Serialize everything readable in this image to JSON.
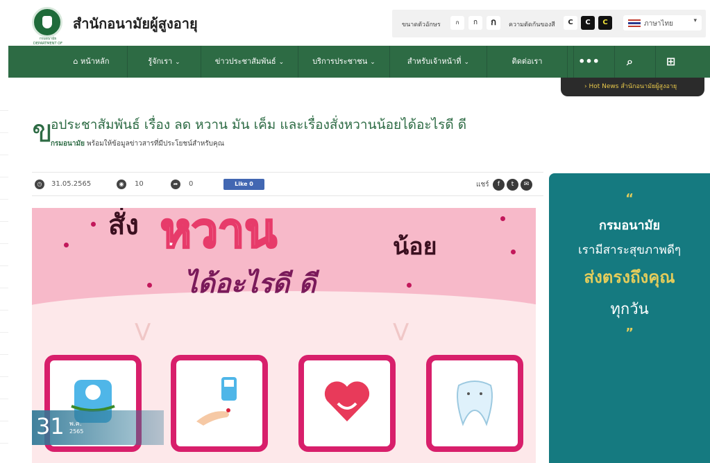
{
  "header": {
    "site_title": "สำนักอนามัยผู้สูงอายุ",
    "logo_caption": "กรมอนามัย DEPARTMENT OF HEALTH",
    "font_size_label": "ขนาดตัวอักษร",
    "font_sizes": [
      "ก",
      "ก",
      "ก"
    ],
    "contrast_label": "ความตัดกันของสี",
    "contrast_options": [
      "C",
      "C",
      "C"
    ],
    "language": "ภาษาไทย"
  },
  "nav": {
    "items": [
      {
        "label": "หน้าหลัก",
        "icon": "home-icon"
      },
      {
        "label": "รู้จักเรา"
      },
      {
        "label": "ข่าวประชาสัมพันธ์"
      },
      {
        "label": "บริการประชาชน"
      },
      {
        "label": "สำหรับเจ้าหน้าที่"
      },
      {
        "label": "ติดต่อเรา"
      }
    ],
    "more": "•••",
    "search": "search-icon",
    "sitemap": "sitemap-icon"
  },
  "hot_news": "Hot News สำนักอนามัยผู้สูงอายุ",
  "article": {
    "lead_letter": "ข",
    "title": "อประชาสัมพันธ์ เรื่อง ลด หวาน มัน เค็ม และเรื่องสั่งหวานน้อยได้อะไรดี ดี",
    "subtitle_bold": "กรมอนามัย",
    "subtitle": "พร้อมให้ข้อมูลข่าวสารที่มีประโยชน์สำหรับคุณ",
    "date": "31.05.2565",
    "views": "10",
    "shares": "0",
    "like": "Like 0",
    "share_label": "แชร์"
  },
  "hero": {
    "line1": "สั่ง",
    "line1_big": "หวาน",
    "line1_end": "น้อย",
    "line2": "ได้อะไรดี ดี",
    "day": "31",
    "month": "พ.ค.",
    "year": "2565"
  },
  "sidebar": {
    "quote_open": "“",
    "line1": "กรมอนามัย",
    "line2": "เรามีสาระสุขภาพดีๆ",
    "line3": "ส่งตรงถึงคุณ",
    "line4": "ทุกวัน",
    "quote_close": "”"
  },
  "colors": {
    "primary_green": "#2d6b44",
    "teal": "#157a80",
    "accent_pink": "#d81f6b",
    "gold": "#e3cc5b"
  }
}
